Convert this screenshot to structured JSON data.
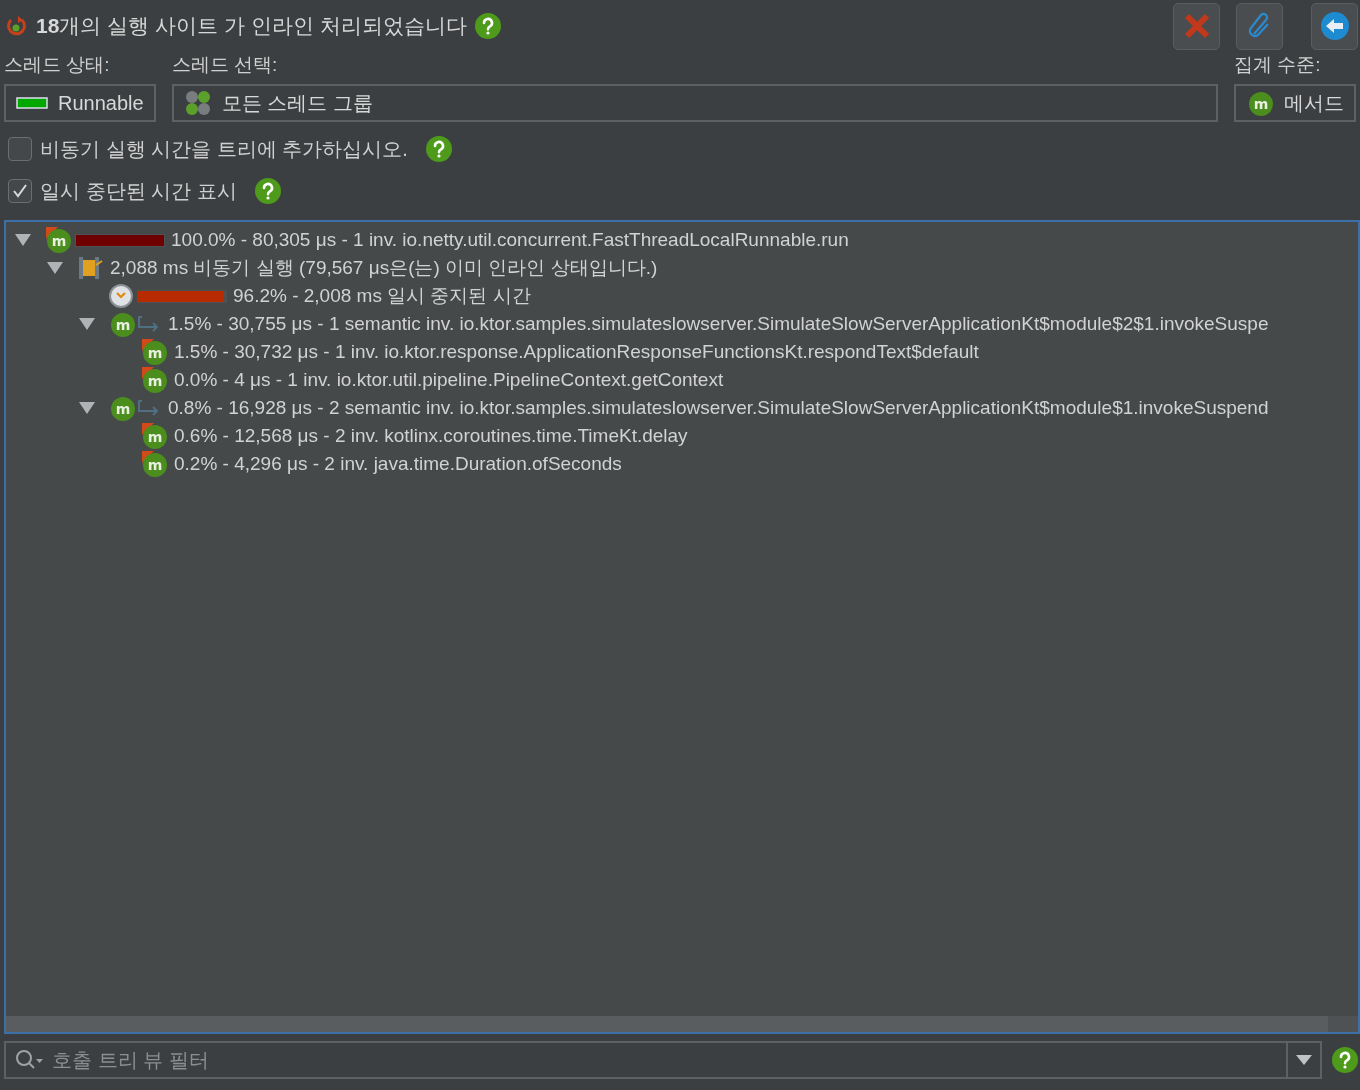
{
  "header": {
    "count": "18",
    "title": "개의 실행 사이트 가 인라인 처리되었습니다"
  },
  "toolbar": [
    {
      "kind": "close"
    },
    {
      "kind": "attach"
    },
    {
      "kind": "back"
    }
  ],
  "thread_state": {
    "label": "스레드 상태:",
    "value": "Runnable",
    "color": "#00a800"
  },
  "thread_select": {
    "label": "스레드 선택:",
    "value": "모든 스레드 그룹"
  },
  "aggregation": {
    "label": "집계 수준:",
    "value": "메서드",
    "icon_label": "m"
  },
  "options": [
    {
      "label": "비동기 실행 시간을 트리에 추가하십시오.",
      "checked": false
    },
    {
      "label": "일시 중단된 시간 표시",
      "checked": true
    }
  ],
  "tree": [
    {
      "kind": "method",
      "icon_label": "m",
      "marked": true,
      "level": 1.0,
      "color": "#6e0000",
      "text": "100.0% - 80,305 μs - 1 inv. io.netty.util.concurrent.FastThreadLocalRunnable.run",
      "expanded": true,
      "children": [
        {
          "kind": "async",
          "text": "2,088 ms 비동기 실행 (79,567 μs은(는) 이미 인라인 상태입니다.)",
          "expanded": true,
          "children": [
            {
              "kind": "paused",
              "level": 0.962,
              "color": "#b82a00",
              "text": "96.2% - 2,008 ms 일시 중지된 시간"
            },
            {
              "kind": "semantic",
              "icon_label": "m",
              "marked": false,
              "text": "1.5% - 30,755 μs - 1 semantic inv. io.ktor.samples.simulateslowserver.SimulateSlowServerApplicationKt$module$2$1.invokeSuspe",
              "expanded": true,
              "children": [
                {
                  "kind": "method",
                  "icon_label": "m",
                  "marked": true,
                  "text": "1.5% - 30,732 μs - 1 inv. io.ktor.response.ApplicationResponseFunctionsKt.respondText$default"
                },
                {
                  "kind": "method",
                  "icon_label": "m",
                  "marked": true,
                  "text": "0.0% - 4 μs - 1 inv. io.ktor.util.pipeline.PipelineContext.getContext"
                }
              ]
            },
            {
              "kind": "semantic",
              "icon_label": "m",
              "marked": false,
              "text": "0.8% - 16,928 μs - 2 semantic inv. io.ktor.samples.simulateslowserver.SimulateSlowServerApplicationKt$module$1.invokeSuspend",
              "expanded": true,
              "children": [
                {
                  "kind": "method",
                  "icon_label": "m",
                  "marked": true,
                  "text": "0.6% - 12,568 μs - 2 inv. kotlinx.coroutines.time.TimeKt.delay"
                },
                {
                  "kind": "method",
                  "icon_label": "m",
                  "marked": true,
                  "text": "0.2% - 4,296 μs - 2 inv. java.time.Duration.ofSeconds"
                }
              ]
            }
          ]
        }
      ]
    }
  ],
  "filter": {
    "placeholder": "호출 트리 뷰 필터"
  }
}
